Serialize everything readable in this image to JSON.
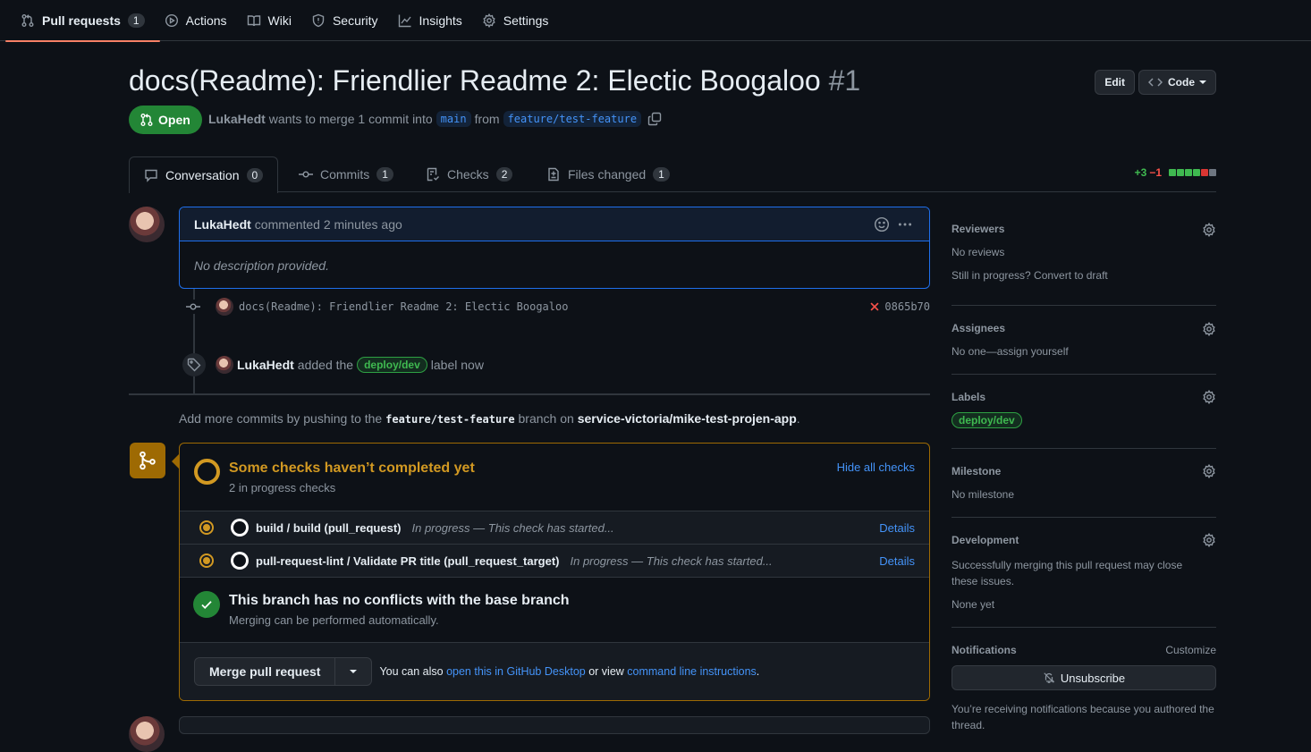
{
  "nav": {
    "items": [
      {
        "label": "Pull requests",
        "count": "1",
        "icon": "git-pull-request-icon"
      },
      {
        "label": "Actions",
        "icon": "play-icon"
      },
      {
        "label": "Wiki",
        "icon": "book-icon"
      },
      {
        "label": "Security",
        "icon": "shield-icon"
      },
      {
        "label": "Insights",
        "icon": "graph-icon"
      },
      {
        "label": "Settings",
        "icon": "gear-icon"
      }
    ]
  },
  "pr": {
    "title": "docs(Readme): Friendlier Readme 2: Electic Boogaloo",
    "number": "#1",
    "state": "Open",
    "author": "LukaHedt",
    "merge_text": "wants to merge 1 commit into",
    "base": "main",
    "from_text": "from",
    "head": "feature/test-feature",
    "edit_label": "Edit",
    "code_label": "Code"
  },
  "tabs": [
    {
      "label": "Conversation",
      "count": "0"
    },
    {
      "label": "Commits",
      "count": "1"
    },
    {
      "label": "Checks",
      "count": "2"
    },
    {
      "label": "Files changed",
      "count": "1"
    }
  ],
  "diffstat": {
    "additions": "+3",
    "deletions": "−1",
    "colors": [
      "#3fb950",
      "#3fb950",
      "#3fb950",
      "#3fb950",
      "#da3633",
      "#6e7681"
    ]
  },
  "comment": {
    "author": "LukaHedt",
    "action": "commented 2 minutes ago",
    "body": "No description provided."
  },
  "commit": {
    "message": "docs(Readme): Friendlier Readme 2: Electic Boogaloo",
    "sha": "0865b70",
    "status": "failed"
  },
  "label_event": {
    "actor": "LukaHedt",
    "text_before": "added the",
    "label": "deploy/dev",
    "text_after": "label now"
  },
  "push_hint": {
    "prefix": "Add more commits by pushing to the",
    "branch": "feature/test-feature",
    "middle": "branch on",
    "repo": "service-victoria/mike-test-projen-app",
    "suffix": "."
  },
  "checks": {
    "title": "Some checks haven’t completed yet",
    "subtitle": "2 in progress checks",
    "toggle": "Hide all checks",
    "items": [
      {
        "name": "build / build (pull_request)",
        "status": "In progress — This check has started...",
        "link": "Details"
      },
      {
        "name": "pull-request-lint / Validate PR title (pull_request_target)",
        "status": "In progress — This check has started...",
        "link": "Details"
      }
    ]
  },
  "conflicts": {
    "title": "This branch has no conflicts with the base branch",
    "subtitle": "Merging can be performed automatically."
  },
  "merge": {
    "button": "Merge pull request",
    "also": "You can also",
    "desktop_link": "open this in GitHub Desktop",
    "or_view": "or view",
    "cli_link": "command line instructions",
    "end": "."
  },
  "sidebar": {
    "reviewers": {
      "title": "Reviewers",
      "value": "No reviews",
      "hint": "Still in progress? Convert to draft"
    },
    "assignees": {
      "title": "Assignees",
      "value": "No one—assign yourself"
    },
    "labels": {
      "title": "Labels",
      "label": "deploy/dev"
    },
    "milestone": {
      "title": "Milestone",
      "value": "No milestone"
    },
    "development": {
      "title": "Development",
      "text": "Successfully merging this pull request may close these issues.",
      "value": "None yet"
    },
    "notifications": {
      "title": "Notifications",
      "customize": "Customize",
      "button": "Unsubscribe",
      "reason": "You’re receiving notifications because you authored the thread."
    }
  }
}
